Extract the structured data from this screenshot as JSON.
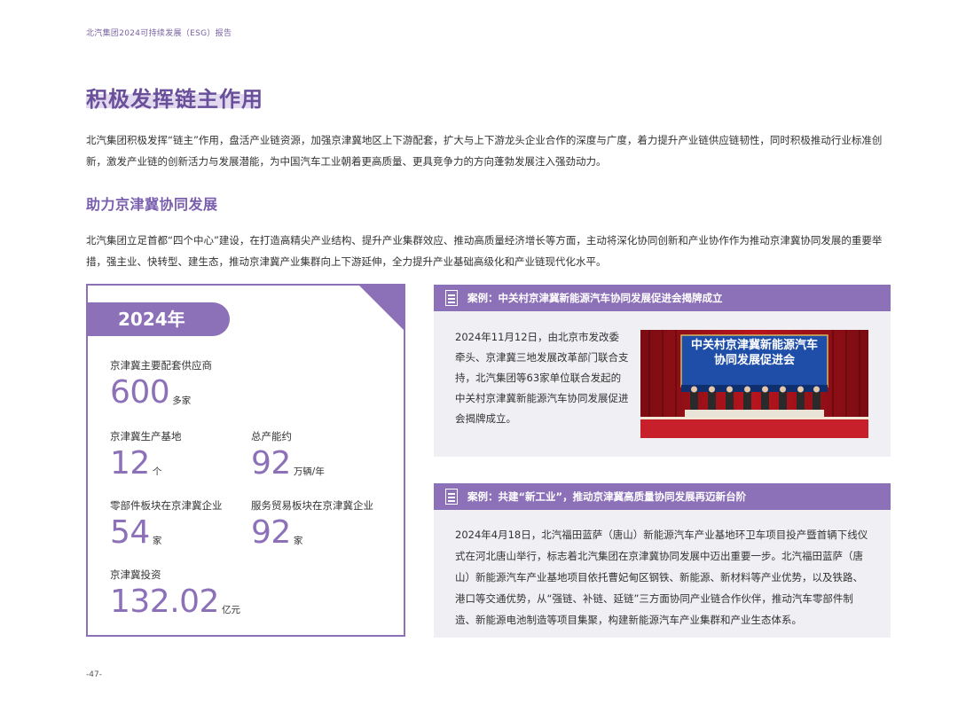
{
  "header": {
    "title": "北汽集团2024可持续发展（ESG）报告"
  },
  "page_title": "积极发挥链主作用",
  "intro": "北汽集团积极发挥“链主”作用，盘活产业链资源，加强京津冀地区上下游配套，扩大与上下游龙头企业合作的深度与广度，着力提升产业链供应链韧性，同时积极推动行业标准创新，激发产业链的创新活力与发展潜能，为中国汽车工业朝着更高质量、更具竞争力的方向蓬勃发展注入强劲动力。",
  "section": {
    "title": "助力京津冀协同发展",
    "text": "北汽集团立足首都“四个中心”建设，在打造高精尖产业结构、提升产业集群效应、推动高质量经济增长等方面，主动将深化协同创新和产业协作作为推动京津冀协同发展的重要举措，强主业、快转型、建生态，推动京津冀产业集群向上下游延伸，全力提升产业基础高级化和产业链现代化水平。"
  },
  "stats": {
    "year": "2024年",
    "items": [
      {
        "label": "京津冀主要配套供应商",
        "value": "600",
        "unit": "多家"
      },
      {
        "label": "京津冀生产基地",
        "value": "12",
        "unit": "个"
      },
      {
        "label": "总产能约",
        "value": "92",
        "unit": "万辆/年"
      },
      {
        "label": "零部件板块在京津冀企业",
        "value": "54",
        "unit": "家"
      },
      {
        "label": "服务贸易板块在京津冀企业",
        "value": "92",
        "unit": "家"
      },
      {
        "label": "京津冀投资",
        "value": "132.02",
        "unit": "亿元"
      }
    ]
  },
  "case1": {
    "title": "案例：中关村京津冀新能源汽车协同发展促进会揭牌成立",
    "text": "2024年11月12日，由北京市发改委牵头、京津冀三地发展改革部门联合支持，北汽集团等63家单位联合发起的中关村京津冀新能源汽车协同发展促进会揭牌成立。",
    "photo_banner_line1": "中关村京津冀新能源汽车",
    "photo_banner_line2": "协同发展促进会"
  },
  "case2": {
    "title": "案例：共建“新工业”，推动京津冀高质量协同发展再迈新台阶",
    "text": "2024年4月18日，北汽福田蓝萨（唐山）新能源汽车产业基地环卫车项目投产暨首辆下线仪式在河北唐山举行，标志着北汽集团在京津冀协同发展中迈出重要一步。北汽福田蓝萨（唐山）新能源汽车产业基地项目依托曹妃甸区钢铁、新能源、新材料等产业优势，以及铁路、港口等交通优势，从“强链、补链、延链”三方面协同产业链合作伙伴，推动汽车零部件制造、新能源电池制造等项目集聚，构建新能源汽车产业集群和产业生态体系。"
  },
  "page_number": "-47-",
  "colors": {
    "accent": "#8d71b8",
    "title": "#6a4f9a",
    "card_bg": "#f0eff3",
    "banner_red": "#c8202a"
  }
}
